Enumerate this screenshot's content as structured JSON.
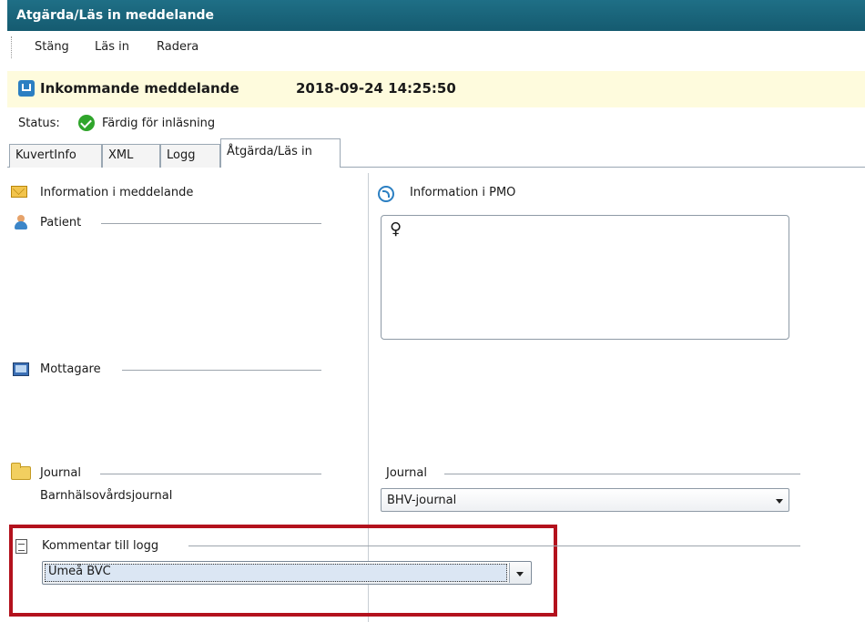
{
  "window": {
    "title": "Atgärda/Läs in meddelande"
  },
  "menu": {
    "items": [
      "Stäng",
      "Läs in",
      "Radera"
    ]
  },
  "header": {
    "title": "Inkommande meddelande",
    "datetime": "2018-09-24 14:25:50"
  },
  "status": {
    "label": "Status:",
    "value": "Färdig för inläsning"
  },
  "tabs": [
    {
      "label": "KuvertInfo"
    },
    {
      "label": "XML"
    },
    {
      "label": "Logg"
    },
    {
      "label": "Åtgärda/Läs in",
      "active": true
    }
  ],
  "left": {
    "info_heading": "Information i meddelande",
    "patient_label": "Patient",
    "recipient_label": "Mottagare",
    "journal_label": "Journal",
    "journal_value": "Barnhälsovårdsjournal",
    "comment_label": "Kommentar till logg",
    "comment_value": "Umeå BVC"
  },
  "right": {
    "info_heading": "Information i PMO",
    "gender_symbol": "♀",
    "journal_label": "Journal",
    "journal_value": "BHV-journal"
  },
  "colors": {
    "titlebar": "#1f6f86",
    "header_band": "#fefbdd",
    "highlight": "#b3121d"
  }
}
